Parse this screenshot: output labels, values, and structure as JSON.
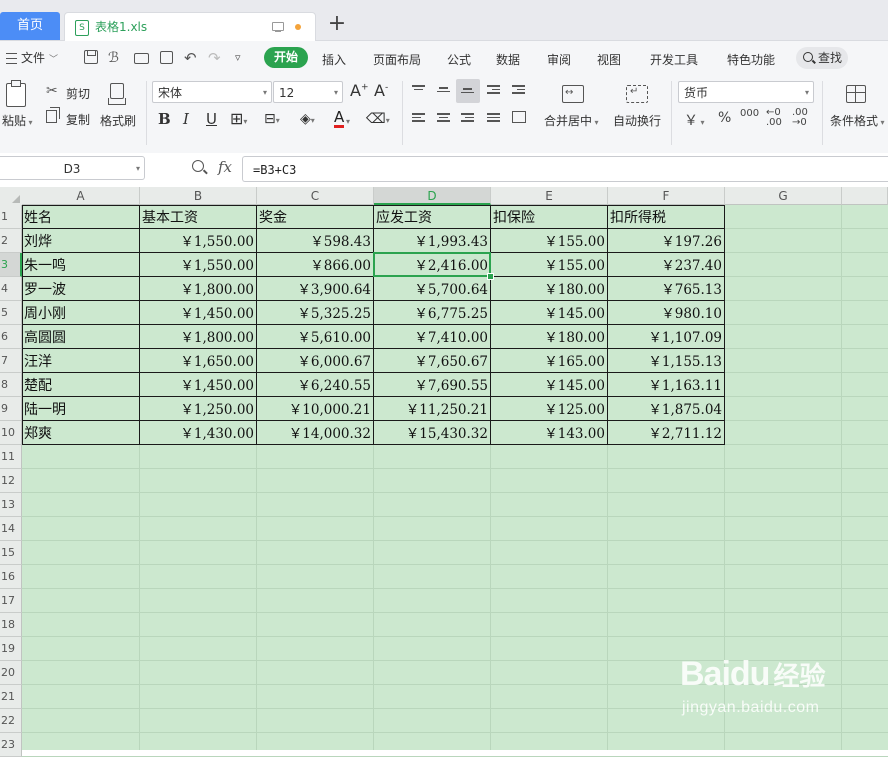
{
  "tabs": {
    "home_label": "首页",
    "file_label": "表格1.xls",
    "new_tab_symbol": "+",
    "file_icon_glyph": "S"
  },
  "menu": {
    "file_label": "文件",
    "items": [
      "开始",
      "插入",
      "页面布局",
      "公式",
      "数据",
      "审阅",
      "视图",
      "开发工具",
      "特色功能"
    ],
    "search_label": "查找"
  },
  "ribbon": {
    "paste_label": "粘贴",
    "cut_label": "剪切",
    "copy_label": "复制",
    "format_painter_label": "格式刷",
    "font_name": "宋体",
    "font_size": "12",
    "bold": "B",
    "italic": "I",
    "underline": "U",
    "merge_label": "合并居中",
    "wrap_label": "自动换行",
    "number_format": "货币",
    "conditional_label": "条件格式",
    "currency_symbol": "￥",
    "percent_symbol": "%",
    "thousands_symbol": "000"
  },
  "formula_bar": {
    "name_box": "D3",
    "fx_label": "fx",
    "formula": "=B3+C3"
  },
  "sheet": {
    "columns": [
      "A",
      "B",
      "C",
      "D",
      "E",
      "F",
      "G"
    ],
    "row_numbers": [
      "1",
      "2",
      "3",
      "4",
      "5",
      "6",
      "7",
      "8",
      "9",
      "10",
      "11",
      "12",
      "13",
      "14",
      "15",
      "16",
      "17",
      "18",
      "19",
      "20",
      "21",
      "22",
      "23"
    ],
    "selected_column": "D",
    "selected_row": "3",
    "headers": [
      "姓名",
      "基本工资",
      "奖金",
      "应发工资",
      "扣保险",
      "扣所得税"
    ],
    "rows": [
      [
        "刘烨",
        "￥1,550.00",
        "￥598.43",
        "￥1,993.43",
        "￥155.00",
        "￥197.26"
      ],
      [
        "朱一鸣",
        "￥1,550.00",
        "￥866.00",
        "￥2,416.00",
        "￥155.00",
        "￥237.40"
      ],
      [
        "罗一波",
        "￥1,800.00",
        "￥3,900.64",
        "￥5,700.64",
        "￥180.00",
        "￥765.13"
      ],
      [
        "周小刚",
        "￥1,450.00",
        "￥5,325.25",
        "￥6,775.25",
        "￥145.00",
        "￥980.10"
      ],
      [
        "高圆圆",
        "￥1,800.00",
        "￥5,610.00",
        "￥7,410.00",
        "￥180.00",
        "￥1,107.09"
      ],
      [
        "汪洋",
        "￥1,650.00",
        "￥6,000.67",
        "￥7,650.67",
        "￥165.00",
        "￥1,155.13"
      ],
      [
        "楚配",
        "￥1,450.00",
        "￥6,240.55",
        "￥7,690.55",
        "￥145.00",
        "￥1,163.11"
      ],
      [
        "陆一明",
        "￥1,250.00",
        "￥10,000.21",
        "￥11,250.21",
        "￥125.00",
        "￥1,875.04"
      ],
      [
        "郑爽",
        "￥1,430.00",
        "￥14,000.32",
        "￥15,430.32",
        "￥143.00",
        "￥2,711.12"
      ]
    ]
  },
  "watermark": {
    "brand": "Baidu",
    "brand_cn": "经验",
    "url": "jingyan.baidu.com"
  },
  "colors": {
    "accent_green": "#2ba34f",
    "home_tab_blue": "#4c8df6",
    "sheet_background": "#cce8cf"
  }
}
